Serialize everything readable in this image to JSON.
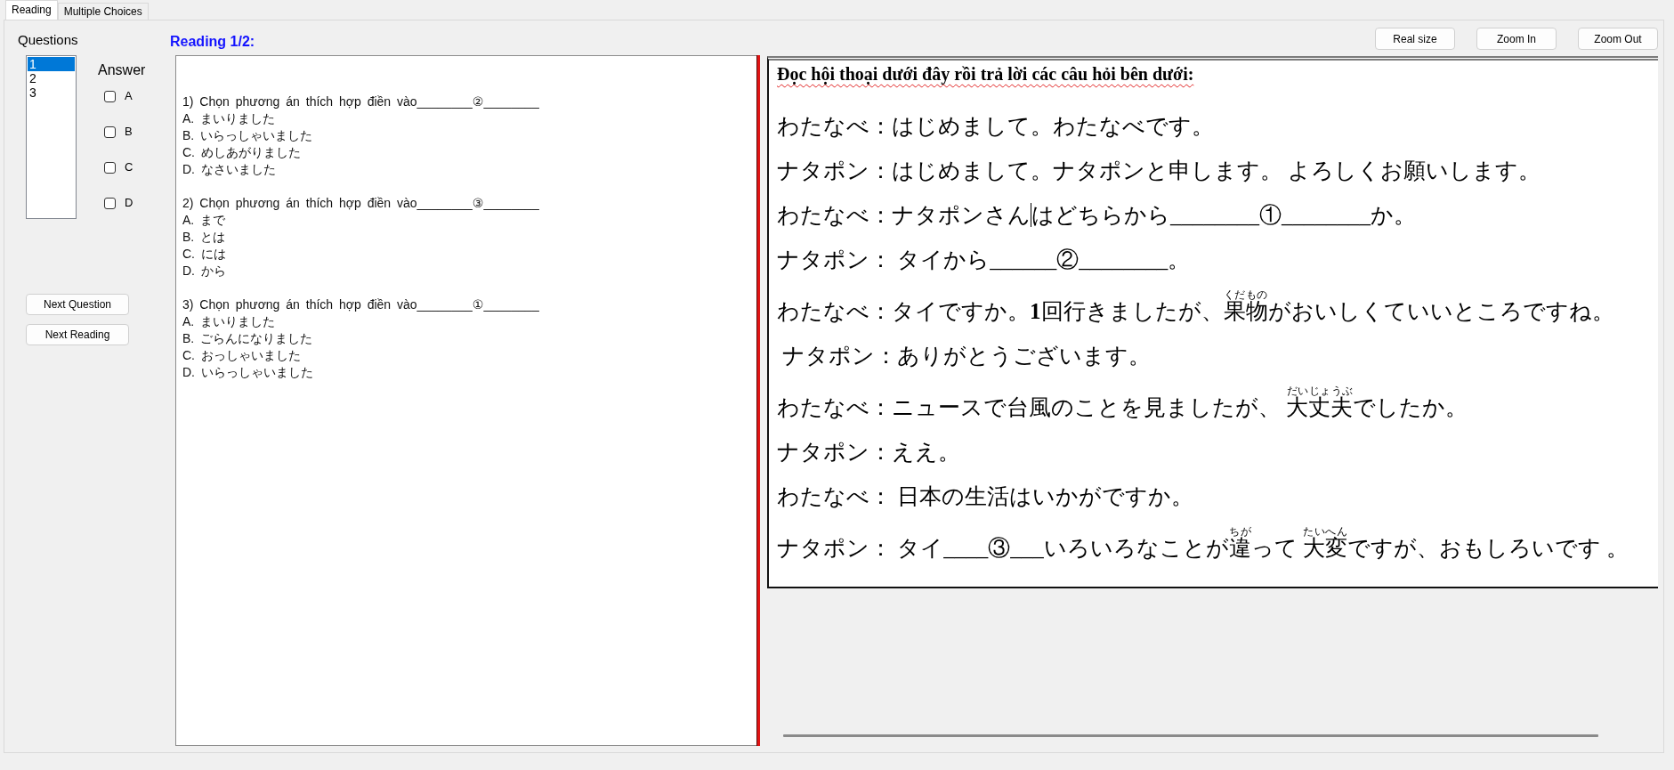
{
  "tabs": [
    {
      "label": "Reading",
      "selected": true
    },
    {
      "label": "Multiple Choices",
      "selected": false
    }
  ],
  "sidebar": {
    "questions_label": "Questions",
    "question_list": [
      {
        "label": "1",
        "selected": true
      },
      {
        "label": "2",
        "selected": false
      },
      {
        "label": "3",
        "selected": false
      }
    ],
    "answer_label": "Answer",
    "answers": [
      {
        "label": "A",
        "checked": false
      },
      {
        "label": "B",
        "checked": false
      },
      {
        "label": "C",
        "checked": false
      },
      {
        "label": "D",
        "checked": false
      }
    ],
    "buttons": [
      "Next Question",
      "Next Reading"
    ]
  },
  "reading_heading": "Reading 1/2:",
  "zoom_buttons": [
    "Real size",
    "Zoom In",
    "Zoom Out"
  ],
  "questions": [
    {
      "prompt": "1) Chọn phương án thích hợp điền vào________②________",
      "options": [
        "A. まいりました",
        "B. いらっしゃいました",
        "C. めしあがりました",
        "D. なさいました"
      ]
    },
    {
      "prompt": "2) Chọn phương án thích hợp điền vào________③________",
      "options": [
        "A. まで",
        "B. とは",
        "C. には",
        "D. から"
      ]
    },
    {
      "prompt": "3) Chọn phương án thích hợp điền vào________①________",
      "options": [
        "A. まいりました",
        "B. ごらんになりました",
        "C. おっしゃいました",
        "D. いらっしゃいました"
      ]
    }
  ],
  "passage": {
    "title": "Đọc hội thoại dưới đây rồi trả lời các câu hỏi bên dưới:",
    "lines": [
      {
        "segments": [
          {
            "kind": "text",
            "text": "わたなべ：はじめまして。わたなべです。"
          }
        ]
      },
      {
        "segments": [
          {
            "kind": "text",
            "text": "ナタポン：はじめまして。ナタポンと申します。 よろしくお願いします。"
          }
        ]
      },
      {
        "segments": [
          {
            "kind": "text",
            "text": "わたなべ：ナタポンさん"
          },
          {
            "kind": "text",
            "text": "はどちらから________①________か。",
            "caret": true
          }
        ]
      },
      {
        "segments": [
          {
            "kind": "text",
            "text": "ナタポン： タイから______②________。"
          }
        ]
      },
      {
        "segments": [
          {
            "kind": "text",
            "text": "わたなべ：タイですか。**1**回行きましたが、"
          },
          {
            "kind": "ruby",
            "text": "果物",
            "ruby": "くだもの"
          },
          {
            "kind": "text",
            "text": "がおいしくていいところですね。"
          }
        ]
      },
      {
        "segments": [
          {
            "kind": "text",
            "text": " ナタポン：ありがとうございます。"
          }
        ]
      },
      {
        "segments": [
          {
            "kind": "text",
            "text": "わたなべ：ニュースで台風のことを見ましたが、 "
          },
          {
            "kind": "ruby",
            "text": "大丈夫",
            "ruby": "だいじょうぶ"
          },
          {
            "kind": "text",
            "text": "でしたか。"
          }
        ]
      },
      {
        "segments": [
          {
            "kind": "text",
            "text": "ナタポン：ええ。"
          }
        ]
      },
      {
        "segments": [
          {
            "kind": "text",
            "text": "わたなべ： 日本の生活はいかがですか。"
          }
        ]
      },
      {
        "segments": [
          {
            "kind": "text",
            "text": "ナタポン： タイ____③___いろいろなことが"
          },
          {
            "kind": "ruby",
            "text": "違",
            "ruby": "ちが"
          },
          {
            "kind": "text",
            "text": "って "
          },
          {
            "kind": "ruby",
            "text": "大変",
            "ruby": "たいへん"
          },
          {
            "kind": "text",
            "text": "ですが、おもしろいです 。"
          }
        ]
      }
    ]
  }
}
